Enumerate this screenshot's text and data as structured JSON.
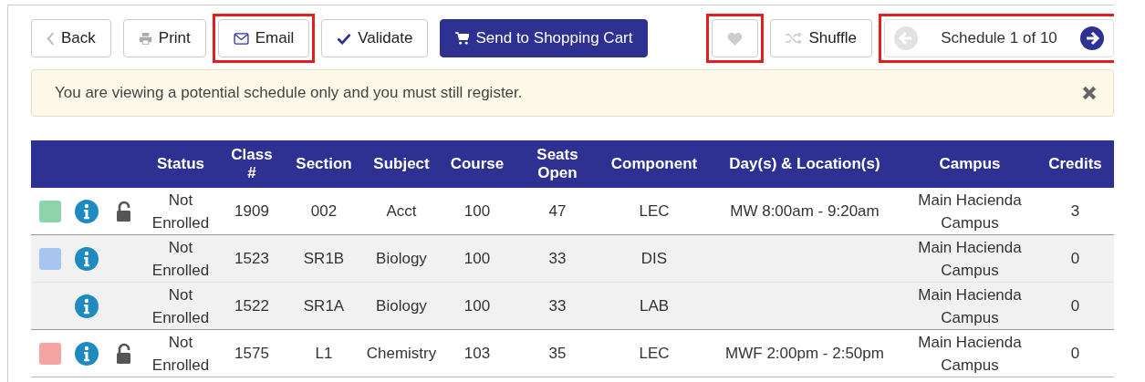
{
  "toolbar": {
    "buttons": [
      {
        "kind": "back",
        "label": "Back",
        "highlighted": false
      },
      {
        "kind": "print",
        "label": "Print",
        "highlighted": false
      },
      {
        "kind": "email",
        "label": "Email",
        "highlighted": true
      },
      {
        "kind": "validate",
        "label": "Validate",
        "highlighted": false
      },
      {
        "kind": "cart",
        "label": "Send to Shopping Cart",
        "highlighted": false
      }
    ],
    "favorite": {
      "highlighted": true
    },
    "shuffle": {
      "label": "Shuffle",
      "highlighted": false
    },
    "pager": {
      "label": "Schedule 1 of 10",
      "prev_disabled": true,
      "next_disabled": false,
      "highlighted": true
    }
  },
  "alert": {
    "message": "You are viewing a potential schedule only and you must still register."
  },
  "table": {
    "columns": [
      "",
      "",
      "",
      "Status",
      "Class\n#",
      "Section",
      "Subject",
      "Course",
      "Seats\nOpen",
      "Component",
      "Day(s) & Location(s)",
      "Campus",
      "Credits"
    ],
    "rows": [
      {
        "color": "#8fd3ad",
        "locked": false,
        "shaded": false,
        "status": "Not Enrolled",
        "class_no": "1909",
        "section": "002",
        "subject": "Acct",
        "course": "100",
        "seats_open": "47",
        "component": "LEC",
        "days_location": "MW 8:00am - 9:20am",
        "campus": "Main Hacienda Campus",
        "credits": "3"
      },
      {
        "color": "#a8c4f0",
        "shaded": true,
        "status": "Not Enrolled",
        "class_no": "1523",
        "section": "SR1B",
        "subject": "Biology",
        "course": "100",
        "seats_open": "33",
        "component": "DIS",
        "days_location": "",
        "campus": "Main Hacienda Campus",
        "credits": "0"
      },
      {
        "shaded": true,
        "status": "Not Enrolled",
        "class_no": "1522",
        "section": "SR1A",
        "subject": "Biology",
        "course": "100",
        "seats_open": "33",
        "component": "LAB",
        "days_location": "",
        "campus": "Main Hacienda Campus",
        "credits": "0"
      },
      {
        "color": "#f5a3a3",
        "locked": false,
        "shaded": false,
        "status": "Not Enrolled",
        "class_no": "1575",
        "section": "L1",
        "subject": "Chemistry",
        "course": "103",
        "seats_open": "35",
        "component": "LEC",
        "days_location": "MWF 2:00pm - 2:50pm",
        "campus": "Main Hacienda Campus",
        "credits": "0"
      }
    ]
  }
}
